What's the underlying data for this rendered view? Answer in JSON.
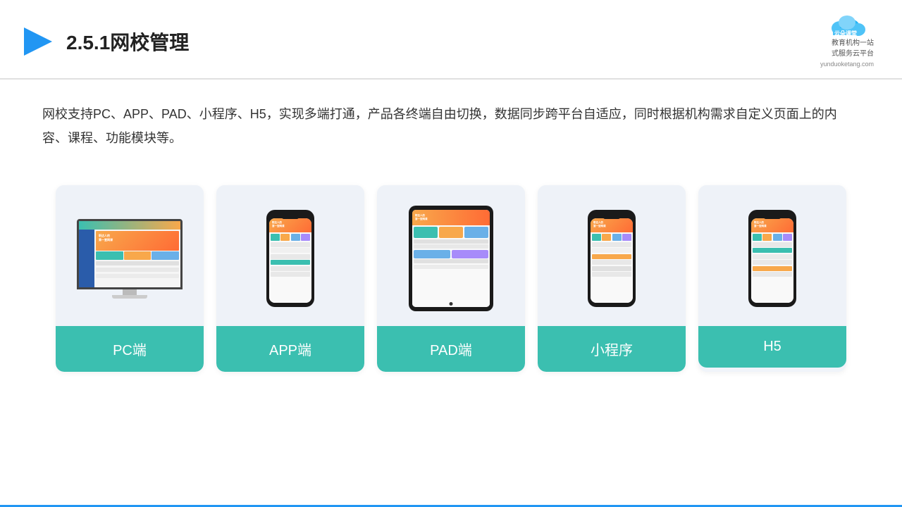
{
  "header": {
    "title": "2.5.1网校管理",
    "logo_brand": "云朵课堂",
    "logo_sub": "教育机构一站\n式服务云平台",
    "logo_url": "yunduoketang.com"
  },
  "description": {
    "text": "网校支持PC、APP、PAD、小程序、H5，实现多端打通，产品各终端自由切换，数据同步跨平台自适应，同时根据机构需求自定义页面上的内容、课程、功能模块等。"
  },
  "cards": [
    {
      "id": "pc",
      "label": "PC端"
    },
    {
      "id": "app",
      "label": "APP端"
    },
    {
      "id": "pad",
      "label": "PAD端"
    },
    {
      "id": "miniprogram",
      "label": "小程序"
    },
    {
      "id": "h5",
      "label": "H5"
    }
  ]
}
